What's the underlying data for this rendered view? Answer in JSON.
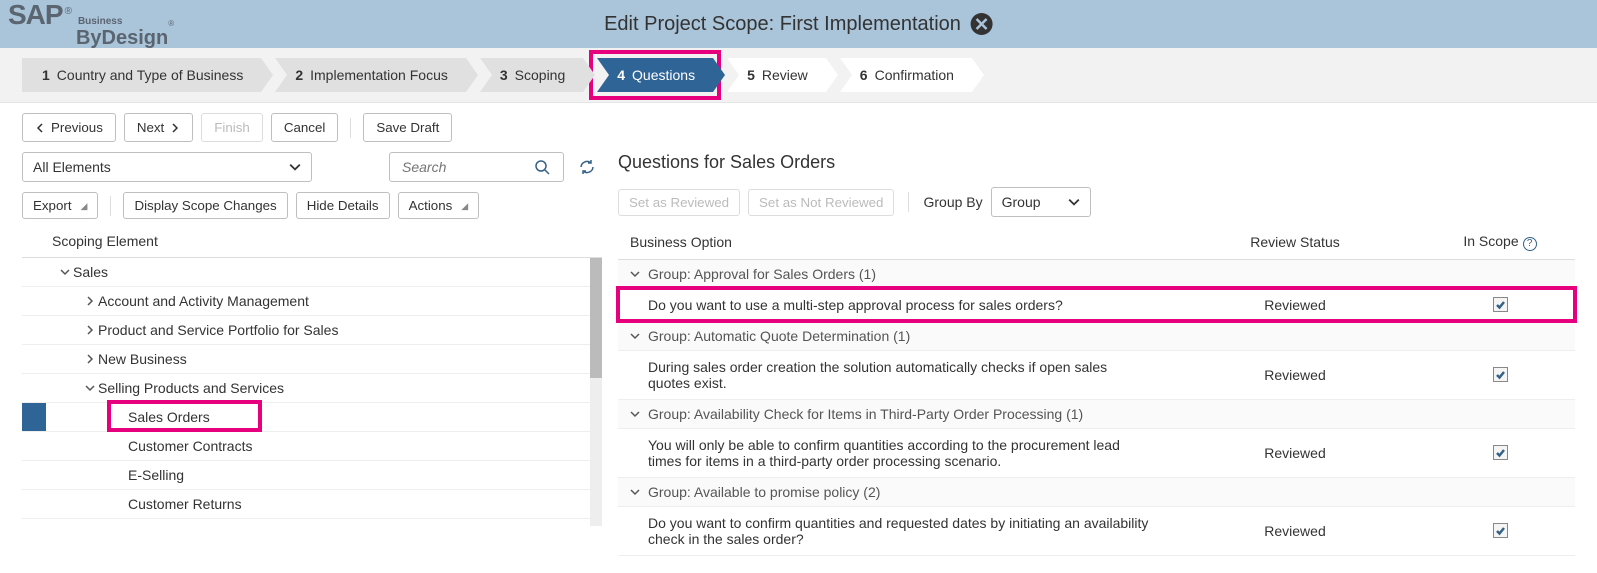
{
  "header": {
    "logo_main": "SAP",
    "logo_sub1": "Business",
    "logo_sub2": "ByDesign",
    "title": "Edit Project Scope: First Implementation"
  },
  "wizard": {
    "steps": [
      {
        "num": "1",
        "label": "Country and Type of Business"
      },
      {
        "num": "2",
        "label": "Implementation Focus"
      },
      {
        "num": "3",
        "label": "Scoping"
      },
      {
        "num": "4",
        "label": "Questions"
      },
      {
        "num": "5",
        "label": "Review"
      },
      {
        "num": "6",
        "label": "Confirmation"
      }
    ]
  },
  "actions": {
    "previous": "Previous",
    "next": "Next",
    "finish": "Finish",
    "cancel": "Cancel",
    "save_draft": "Save Draft"
  },
  "left": {
    "filter_value": "All Elements",
    "search_placeholder": "Search",
    "export": "Export",
    "display_scope": "Display Scope Changes",
    "hide_details": "Hide Details",
    "actions": "Actions",
    "col_header": "Scoping Element",
    "tree": {
      "n0": "Sales",
      "n1": "Account and Activity Management",
      "n2": "Product and Service Portfolio for Sales",
      "n3": "New Business",
      "n4": "Selling Products and Services",
      "n5": "Sales Orders",
      "n6": "Customer Contracts",
      "n7": "E-Selling",
      "n8": "Customer Returns"
    }
  },
  "right": {
    "title": "Questions for Sales Orders",
    "set_reviewed": "Set as Reviewed",
    "set_not_reviewed": "Set as Not Reviewed",
    "group_by_label": "Group By",
    "group_by_value": "Group",
    "col1": "Business Option",
    "col2": "Review Status",
    "col3": "In Scope",
    "groups": {
      "g1": "Group: Approval for Sales Orders (1)",
      "g2": "Group: Automatic Quote Determination (1)",
      "g3": "Group: Availability Check for Items in Third-Party Order Processing (1)",
      "g4": "Group: Available to promise policy (2)"
    },
    "items": {
      "i1": "Do you want to use a multi-step approval process for sales orders?",
      "i2": "During sales order creation the solution automatically checks if open sales quotes exist.",
      "i3": "You will only be able to confirm quantities according to the procurement lead times for items in a third-party order processing scenario.",
      "i4": "Do you want to confirm quantities and requested dates by initiating an availability check in the sales order?"
    },
    "status_reviewed": "Reviewed"
  }
}
